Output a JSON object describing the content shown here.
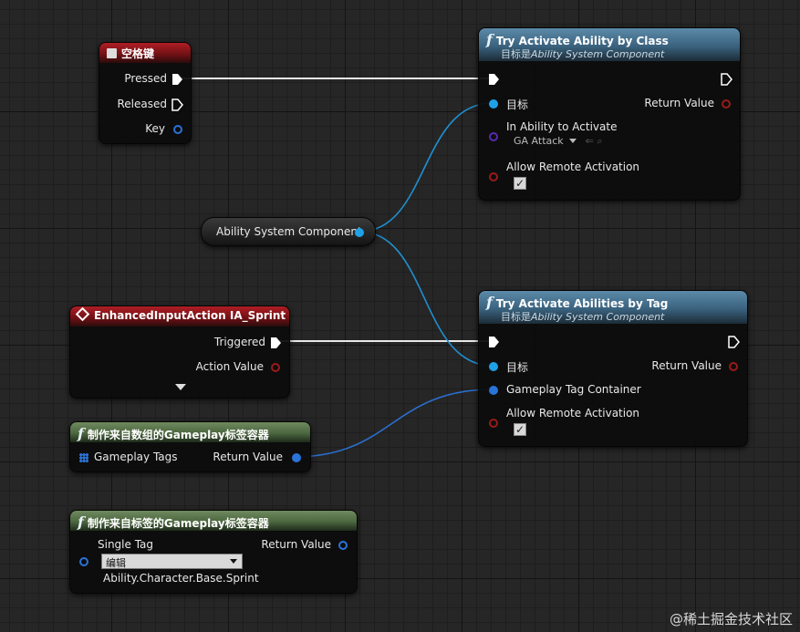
{
  "nodes": {
    "spacebar": {
      "title": "空格键",
      "pins": {
        "pressed": "Pressed",
        "released": "Released",
        "key": "Key"
      }
    },
    "asc_var": {
      "label": "Ability System Component"
    },
    "enhanced_input": {
      "title": "EnhancedInputAction IA_Sprint",
      "pins": {
        "triggered": "Triggered",
        "action_value": "Action Value"
      }
    },
    "make_from_array": {
      "title": "制作来自数组的Gameplay标签容器",
      "pins": {
        "gameplay_tags": "Gameplay Tags",
        "return_value": "Return Value"
      }
    },
    "make_from_tag": {
      "title": "制作来自标签的Gameplay标签容器",
      "pins": {
        "single_tag": "Single Tag",
        "return_value": "Return Value"
      },
      "dropdown_value": "编辑",
      "tag_value": "Ability.Character.Base.Sprint"
    },
    "try_by_class": {
      "title": "Try Activate Ability by Class",
      "subtitle_prefix": "目标是",
      "subtitle_target": "Ability System Component",
      "pins": {
        "target": "目标",
        "return_value": "Return Value",
        "in_ability": "In Ability to Activate",
        "allow_remote": "Allow Remote Activation"
      },
      "ability_class_value": "GA Attack"
    },
    "try_by_tag": {
      "title": "Try Activate Abilities by Tag",
      "subtitle_prefix": "目标是",
      "subtitle_target": "Ability System Component",
      "pins": {
        "target": "目标",
        "return_value": "Return Value",
        "tag_container": "Gameplay Tag Container",
        "allow_remote": "Allow Remote Activation"
      }
    }
  },
  "checkbox_mark": "✓",
  "watermark": "@稀土掘金技术社区",
  "colors": {
    "object_pin": "#1fa1e6",
    "struct_pin": "#2a73d8",
    "bool_pin": "#9a1a1a",
    "class_pin": "#5a2ab0",
    "exec_pin": "#ffffff"
  }
}
